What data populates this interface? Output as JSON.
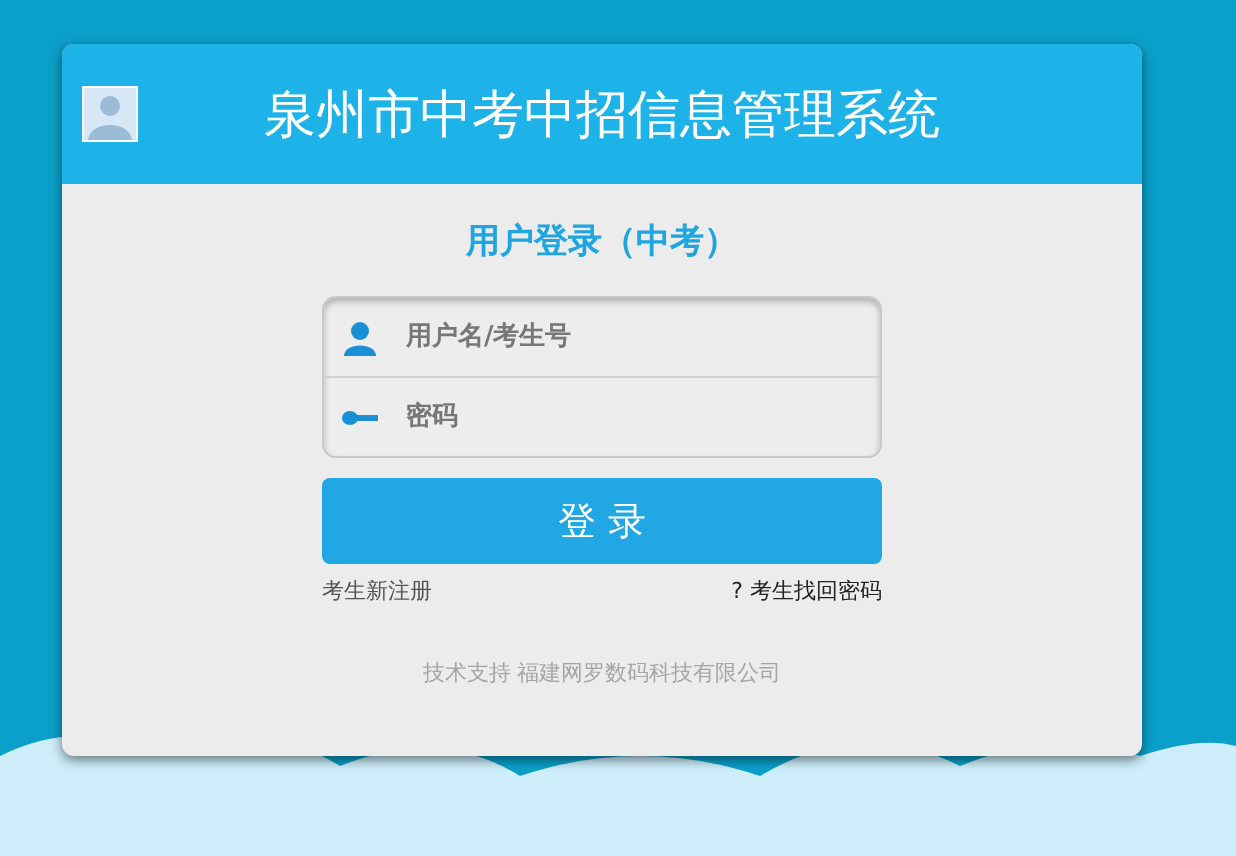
{
  "header": {
    "title": "泉州市中考中招信息管理系统"
  },
  "login": {
    "heading": "用户登录（中考）",
    "fields": [
      {
        "kind": "user",
        "placeholder": "用户名/考生号"
      },
      {
        "kind": "password",
        "placeholder": "密码"
      }
    ],
    "submit": "登 录",
    "links": [
      "考生新注册",
      "? 考生找回密码"
    ]
  },
  "footer": "技术支持 福建网罗数码科技有限公司"
}
